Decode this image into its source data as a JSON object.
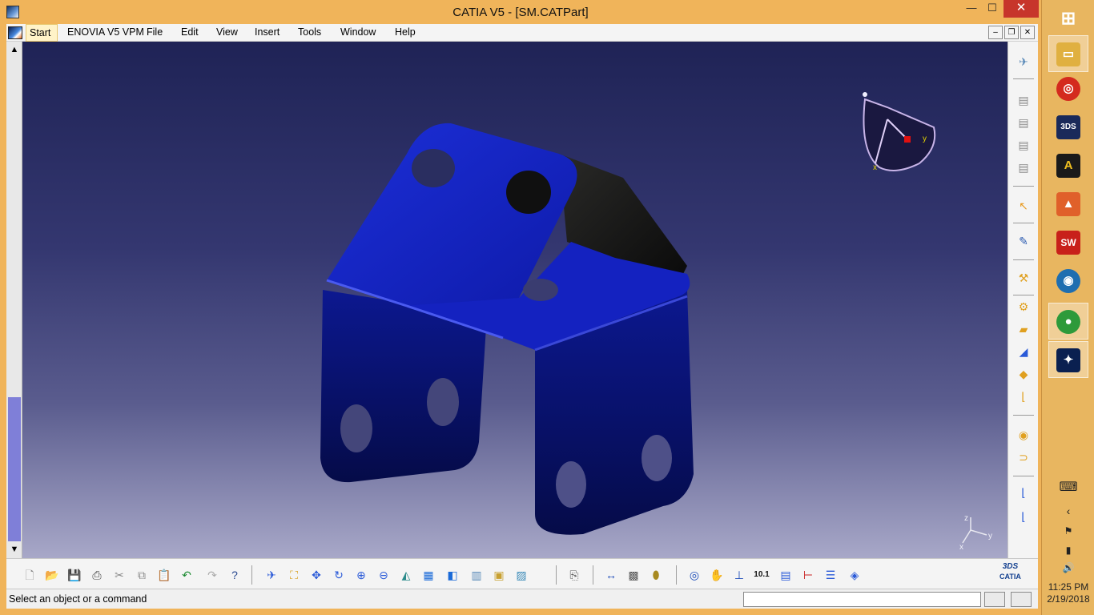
{
  "window": {
    "title": "CATIA V5 - [SM.CATPart]",
    "min_glyph": "—",
    "max_glyph": "☐",
    "close_glyph": "✕"
  },
  "menubar": {
    "items": [
      "Start",
      "ENOVIA V5 VPM",
      "File",
      "Edit",
      "View",
      "Insert",
      "Tools",
      "Window",
      "Help"
    ],
    "mdi_min": "–",
    "mdi_restore": "❐",
    "mdi_close": "✕"
  },
  "viewport": {
    "compass_labels": {
      "x": "x",
      "y": "y",
      "z": "z"
    },
    "axis_labels": {
      "x": "x",
      "y": "y",
      "z": "z"
    },
    "scroll_up": "▲",
    "scroll_down": "▼"
  },
  "right_toolbar": {
    "icons": [
      "tree-expand-icon",
      "insert-body-icon",
      "insert-geometric-set-icon",
      "ordered-geometric-set-icon",
      "assembly-body-icon",
      "select-icon",
      "sketch-icon",
      "sketch-analysis-icon",
      "sheet-metal-parameters-icon",
      "wall-icon",
      "extrusion-icon",
      "flange-icon",
      "swept-walls-icon",
      "hopper-icon",
      "cutout-icon",
      "hole-icon",
      "unfold-icon",
      "fold-icon"
    ]
  },
  "bottom_toolbar": {
    "icons": [
      "new-icon",
      "open-icon",
      "save-icon",
      "print-icon",
      "cut-icon",
      "copy-icon",
      "paste-icon",
      "undo-icon",
      "redo-icon",
      "whats-this-icon",
      "fly-mode-icon",
      "fit-all-icon",
      "pan-icon",
      "rotate-icon",
      "zoom-in-icon",
      "zoom-out-icon",
      "normal-view-icon",
      "multi-view-icon",
      "iso-view-icon",
      "hide-show-icon",
      "swap-space-icon",
      "shading-icon",
      "std-toolbar-icon",
      "measure-icon",
      "inertia-icon",
      "material-icon",
      "power-copy-icon",
      "knowledge-icon",
      "axis-icon",
      "units-icon",
      "catalog-icon",
      "constraint-icon",
      "list-icon",
      "publish-icon"
    ],
    "ds_logo_top": "3DS",
    "ds_logo_bottom": "CATIA"
  },
  "statusbar": {
    "message": "Select an object or a command",
    "command_input": ""
  },
  "taskbar": {
    "start_glyph": "⊞",
    "apps": [
      {
        "name": "file-explorer",
        "glyph": "▭",
        "color": "#e0b040"
      },
      {
        "name": "app-red-circle",
        "glyph": "◎",
        "color": "#d42a1e"
      },
      {
        "name": "3dexperience",
        "glyph": "3DS",
        "color": "#1a2a5a"
      },
      {
        "name": "autodesk-a",
        "glyph": "A",
        "color": "#1a1a1a"
      },
      {
        "name": "matlab",
        "glyph": "▲",
        "color": "#e0602a"
      },
      {
        "name": "solidworks-2016",
        "glyph": "SW",
        "color": "#c8201a"
      },
      {
        "name": "keyshot",
        "glyph": "◉",
        "color": "#1e6eb0"
      },
      {
        "name": "chrome",
        "glyph": "●",
        "color": "#2e9a3a"
      },
      {
        "name": "catia",
        "glyph": "✦",
        "color": "#0a2050"
      }
    ],
    "tray": {
      "keyboard": "⌨",
      "chevron": "‹",
      "flag": "⚑",
      "battery": "▮",
      "volume": "🔊"
    },
    "time": "11:25 PM",
    "date": "2/19/2018"
  }
}
